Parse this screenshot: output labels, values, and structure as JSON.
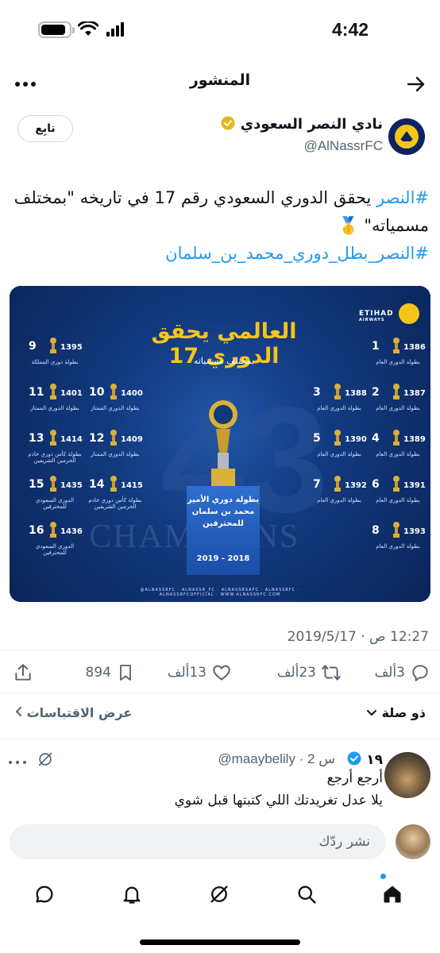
{
  "status_bar": {
    "time": "4:42"
  },
  "header": {
    "title": "المنشور"
  },
  "author": {
    "name": "نادي النصر السعودي",
    "handle": "@AlNassrFC",
    "follow_label": "تابِع"
  },
  "tweet": {
    "hashtag1": "#النصر",
    "text1": " يحقق الدوري السعودي رقم 17 في تاريخه \"بمختلف مسمياته\" 🥇",
    "hashtag2": "#النصر_بطل_دوري_محمد_بن_سلمان"
  },
  "media": {
    "title": "العالمي يحقق الدوري 17",
    "subtitle": "بمختلف مسمياته",
    "big_number": "43",
    "watermark": "CHAMPIONS",
    "sponsor": "ETIHAD",
    "sponsor_sub": "AIRWAYS",
    "pedestal_text": "بطولة دوري الأمير محمد بن سلمان للمحترفين",
    "pedestal_years": "2019 - 2018",
    "footer": "@ALNASSRFC · ALNASSR_FC · ALNASSRSAFC · ALNASSRFC · ALNASSRFCOFFICIAL · WWW.ALNASSRFC.COM",
    "right_column": [
      {
        "num": "1",
        "year": "1386",
        "label": "بطولة الدوري العام"
      },
      {
        "num": "2",
        "year": "1387",
        "label": "بطولة الدوري العام"
      },
      {
        "num": "4",
        "year": "1389",
        "label": "بطولة الدوري العام"
      },
      {
        "num": "6",
        "year": "1391",
        "label": "بطولة الدوري العام"
      },
      {
        "num": "8",
        "year": "1393",
        "label": "بطولة الدوري العام"
      }
    ],
    "right_inner_column": [
      {
        "num": "3",
        "year": "1388",
        "label": "بطولة الدوري العام"
      },
      {
        "num": "5",
        "year": "1390",
        "label": "بطولة الدوري العام"
      },
      {
        "num": "7",
        "year": "1392",
        "label": "بطولة الدوري العام"
      }
    ],
    "left_column": [
      {
        "num": "9",
        "year": "1395",
        "label": "بطولة دوري المملكة"
      },
      {
        "num": "11",
        "year": "1401",
        "label": "بطولة الدوري الممتاز"
      },
      {
        "num": "13",
        "year": "1414",
        "label": "بطولة كأس دوري خادم الحرمين الشريفين"
      },
      {
        "num": "15",
        "year": "1435",
        "label": "الدوري السعودي للمحترفين"
      },
      {
        "num": "16",
        "year": "1436",
        "label": "الدوري السعودي للمحترفين"
      }
    ],
    "left_inner_column": [
      {
        "num": "10",
        "year": "1400",
        "label": "بطولة الدوري الممتاز"
      },
      {
        "num": "12",
        "year": "1409",
        "label": "بطولة الدوري الممتاز"
      },
      {
        "num": "14",
        "year": "1415",
        "label": "بطولة كأس دوري خادم الحرمين الشريفين"
      }
    ]
  },
  "timestamp": "12:27 ص · 2019/5/17",
  "actions": {
    "replies": "3ألف",
    "retweets": "23ألف",
    "likes": "13ألف",
    "bookmarks": "894"
  },
  "quotes": {
    "relevance": "ذو صلة",
    "view_quotes": "عرض الاقتباسات"
  },
  "reply": {
    "name": "١٩",
    "handle_time": "@maaybelily · 2 س",
    "line1": "أرجع أرجع",
    "line2": "يلا عدل تغريدتك اللي كتبتها قبل شوي"
  },
  "reply_input": {
    "placeholder": "نشر ردّك"
  },
  "colors": {
    "accent": "#1d9bf0",
    "text": "#0f1419",
    "muted": "#536471",
    "gold": "#f5c518",
    "navy": "#0c2461"
  }
}
